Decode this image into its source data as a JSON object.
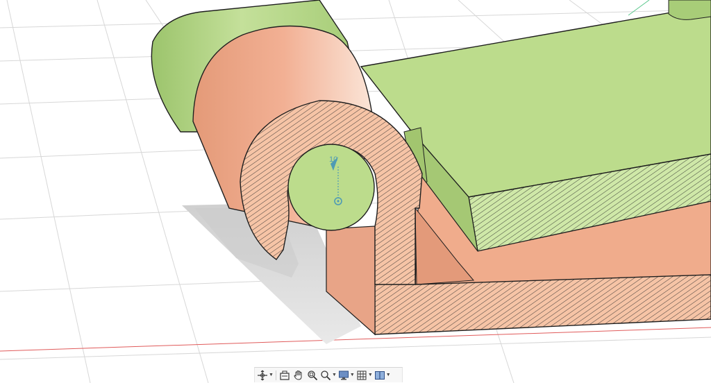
{
  "viewport": {
    "dimension_value": "10"
  },
  "colors": {
    "green_body": "#bcdc8c",
    "orange_body": "#f0ac8c",
    "grid_line": "#d7d7d7",
    "x_axis": "#e05a5a",
    "y_axis": "#5ac88c",
    "hatch": "#2a2a2a",
    "sketch_blue": "#4f9bb4"
  },
  "toolbar": {
    "items": [
      {
        "icon": "orbit-icon",
        "has_dropdown": true
      },
      {
        "icon": "look-at-icon",
        "has_dropdown": false
      },
      {
        "icon": "pan-hand-icon",
        "has_dropdown": false
      },
      {
        "icon": "zoom-window-icon",
        "has_dropdown": false
      },
      {
        "icon": "zoom-icon",
        "has_dropdown": true
      },
      {
        "icon": "display-settings-icon",
        "has_dropdown": true
      },
      {
        "icon": "grid-settings-icon",
        "has_dropdown": true
      },
      {
        "icon": "viewports-icon",
        "has_dropdown": true
      }
    ]
  }
}
